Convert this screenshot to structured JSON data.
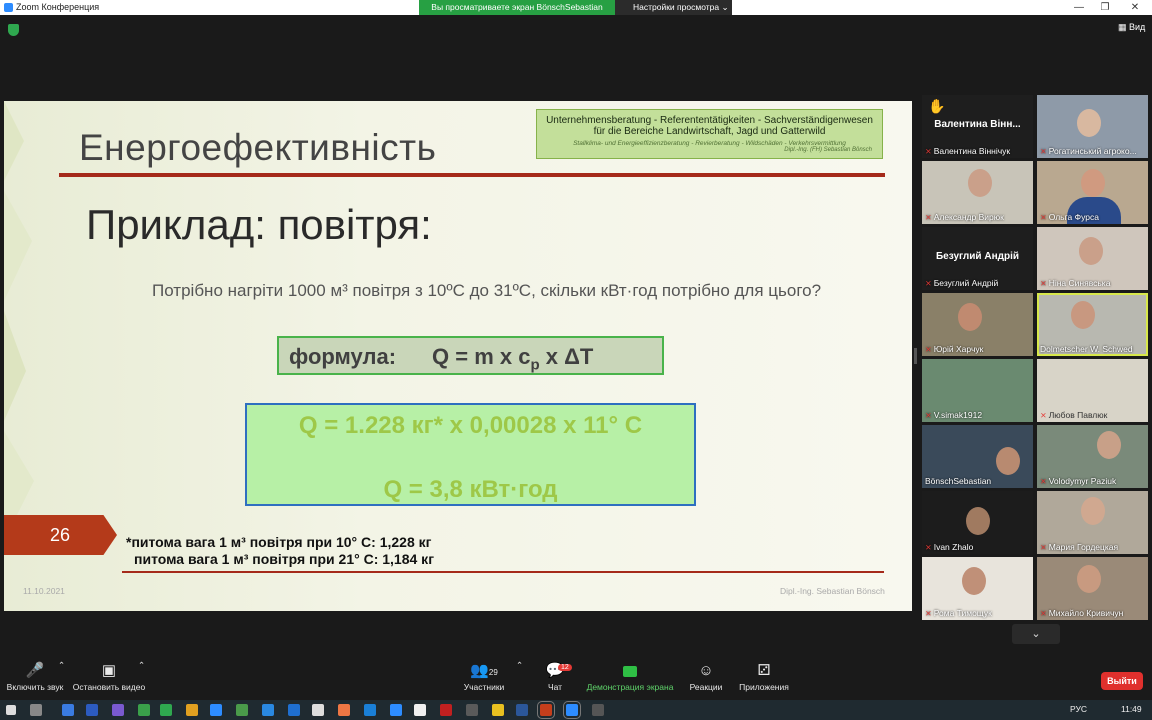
{
  "window": {
    "title": "Zoom Конференция"
  },
  "share_banner": {
    "text": "Вы просматриваете экран BönschSebastian"
  },
  "view_options": {
    "label": "Настройки просмотра"
  },
  "view_button": {
    "label": "Вид"
  },
  "slide": {
    "title": "Енергоефективність",
    "logo_line1": "Unternehmensberatung  -  Referententätigkeiten  -  Sachverständigenwesen",
    "logo_line2": "für die Bereiche Landwirtschaft, Jagd und Gatterwild",
    "logo_line3": "Stallklima- und Energieeffizienzberatung - Revierberatung - Wildschäden - Verkehrsvermittlung",
    "logo_line4": "Dipl.-Ing. (FH) Sebastian Bönsch",
    "subtitle": "Приклад: повітря:",
    "question": "Потрібно нагріти 1000 м³ повітря з 10ºС до 31ºС, скільки кВт·год потрібно для цього?",
    "formula_label": "формула:",
    "formula": "Q = m x c",
    "formula_sub": "p",
    "formula_tail": " x ΔT",
    "calc_line1": "Q = 1.228 кг* x 0,00028 x 11° C",
    "calc_line2": "Q = 3,8 кВт·год",
    "slide_number": "26",
    "footnote1": "*питома вага 1 м³ повітря при 10° С: 1,228 кг",
    "footnote2": "питома вага 1 м³ повітря при 21° С: 1,184 кг",
    "date": "11.10.2021",
    "author": "Dipl.-Ing. Sebastian Bönsch"
  },
  "participants": [
    {
      "name": "Валентина Віннічук",
      "big_label": "Валентина  Вінн...",
      "hand": "✋"
    },
    {
      "name": "Рогатинський агроко..."
    },
    {
      "name": "Александр Вирюк"
    },
    {
      "name": "Ольга Фурса"
    },
    {
      "name": "Безуглий Андрій",
      "big_label": "Безуглий Андрій"
    },
    {
      "name": "Ніна Синявська"
    },
    {
      "name": "Юрій Харчук"
    },
    {
      "name": "Dolmetscher W. Schwed"
    },
    {
      "name": "V.simak1912"
    },
    {
      "name": "Любов Павлюк"
    },
    {
      "name": "BönschSebastian"
    },
    {
      "name": "Volodymyr Paziuk"
    },
    {
      "name": "Ivan Zhalo"
    },
    {
      "name": "Мария Гордецкая"
    },
    {
      "name": "Рома Тимощук"
    },
    {
      "name": "Михайло Кривичун"
    }
  ],
  "toolbar": {
    "mute": "Включить звук",
    "video": "Остановить видео",
    "participants": "Участники",
    "participants_count": "29",
    "chat": "Чат",
    "chat_badge": "12",
    "share": "Демонстрация экрана",
    "reactions": "Реакции",
    "apps": "Приложения",
    "leave": "Выйти"
  },
  "taskbar": {
    "lang": "РУС",
    "time": "11:49"
  },
  "colors": {
    "share_green": "#27a043",
    "accent_red": "#a52a1a",
    "leave_red": "#e0302d",
    "calc_green": "#b7f0a6",
    "active_speaker": "#d8e84b"
  }
}
